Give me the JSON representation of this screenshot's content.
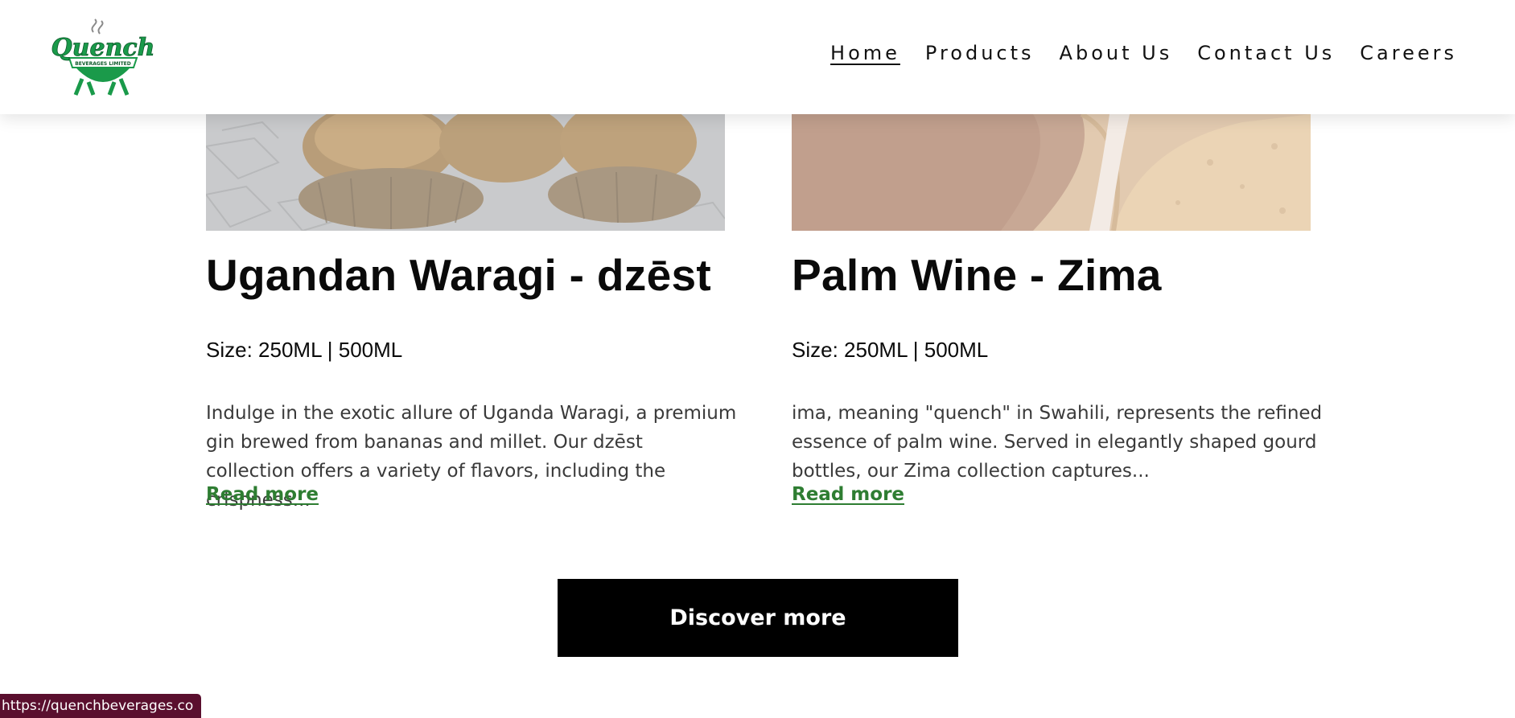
{
  "header": {
    "logo": {
      "wordmark": "Quench",
      "tagline": "BEVERAGES LIMITED",
      "brand_color": "#1a9a4a"
    },
    "nav": [
      {
        "label": "Home",
        "active": true
      },
      {
        "label": "Products",
        "active": false
      },
      {
        "label": "About Us",
        "active": false
      },
      {
        "label": "Contact Us",
        "active": false
      },
      {
        "label": "Careers",
        "active": false
      }
    ]
  },
  "products": [
    {
      "title": "Ugandan Waragi - dzēst",
      "size": "Size: 250ML | 500ML",
      "description": "Indulge in the exotic allure of Uganda Waragi, a premium gin brewed from bananas and millet. Our dzēst collection offers a variety of flavors, including the crispness...",
      "read_more": "Read more"
    },
    {
      "title": "Palm Wine - Zima",
      "size": "Size: 250ML | 500ML",
      "description": "ima, meaning \"quench\" in Swahili, represents the refined essence of palm wine. Served in elegantly shaped gourd bottles, our Zima collection captures...",
      "read_more": "Read more"
    }
  ],
  "cta": {
    "discover_label": "Discover more"
  },
  "status_bar": {
    "url": "https://quenchbeverages.co"
  },
  "colors": {
    "accent_link": "#2e7d32",
    "button_bg": "#000000",
    "status_bg": "#5a0f2e"
  }
}
